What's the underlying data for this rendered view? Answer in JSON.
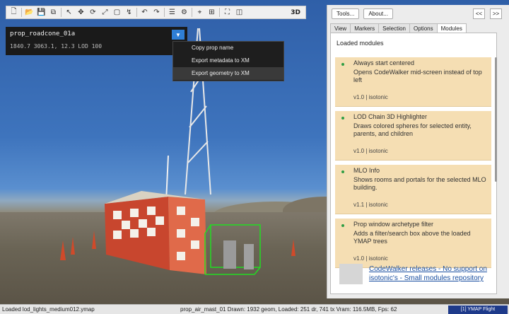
{
  "toolbar": {
    "buttons": [
      {
        "name": "new-icon",
        "glyph": "🗋"
      },
      {
        "name": "open-icon",
        "glyph": "📂"
      },
      {
        "name": "save-icon",
        "glyph": "💾"
      },
      {
        "name": "save-all-icon",
        "glyph": "⧉"
      },
      {
        "name": "pointer-icon",
        "glyph": "↖"
      },
      {
        "name": "move-icon",
        "glyph": "✥"
      },
      {
        "name": "rotate-icon",
        "glyph": "⟳"
      },
      {
        "name": "scale-icon",
        "glyph": "⤢"
      },
      {
        "name": "box-select-icon",
        "glyph": "▢"
      },
      {
        "name": "path-icon",
        "glyph": "↯"
      },
      {
        "name": "undo-icon",
        "glyph": "↶"
      },
      {
        "name": "redo-icon",
        "glyph": "↷"
      },
      {
        "name": "list-icon",
        "glyph": "☰"
      },
      {
        "name": "camera-icon",
        "glyph": "⚙"
      },
      {
        "name": "snap-icon",
        "glyph": "⌖"
      },
      {
        "name": "grid-icon",
        "glyph": "⊞"
      },
      {
        "name": "fullscreen-icon",
        "glyph": "⛶"
      },
      {
        "name": "camera-move-icon",
        "glyph": "◫"
      }
    ],
    "mode_label": "3D"
  },
  "selection": {
    "name": "prop_roadcone_01a",
    "coords": "1840.7  3063.1, 12.3  LOD  100",
    "dropdown_glyph": "▼"
  },
  "context_menu": {
    "items": [
      "Copy prop name",
      "Export metadata to XM",
      "Export geometry to XM"
    ]
  },
  "right_panel": {
    "top_buttons": [
      "Tools...",
      "About..."
    ],
    "nav_prev": "<<",
    "nav_next": ">>",
    "tabs": [
      "View",
      "Markers",
      "Selection",
      "Options",
      "Modules"
    ],
    "active_tab": 4,
    "modules_heading": "Loaded modules",
    "modules": [
      {
        "title": "Always start centered",
        "desc": "Opens CodeWalker mid-screen instead of top left",
        "meta": "v1.0  |  isotonic"
      },
      {
        "title": "LOD Chain 3D Highlighter",
        "desc": "Draws colored spheres for selected entity, parents, and children",
        "meta": "v1.0  |  isotonic"
      },
      {
        "title": "MLO Info",
        "desc": "Shows rooms and portals for the selected MLO building.",
        "meta": "v1.1  |  isotonic"
      },
      {
        "title": "Prop window archetype filter",
        "desc": "Adds a filter/search box above the loaded YMAP trees",
        "meta": "v1.0  |  isotonic"
      }
    ],
    "footer_link": "CodeWalker releases - No support on isotonic's - Small modules repository"
  },
  "statusbar": {
    "left": "Loaded lod_lights_medium012.ymap",
    "right": "prop_air_mast_01  Drawn: 1932 geom, Loaded: 251 dr, 741 tx  Vram: 116.5MB, Fps: 62",
    "button": "[1] YMAP Flight"
  },
  "colors": {
    "accent": "#2f7fd6",
    "module_card": "#f5deb3",
    "status_button": "#1e3a8a"
  }
}
